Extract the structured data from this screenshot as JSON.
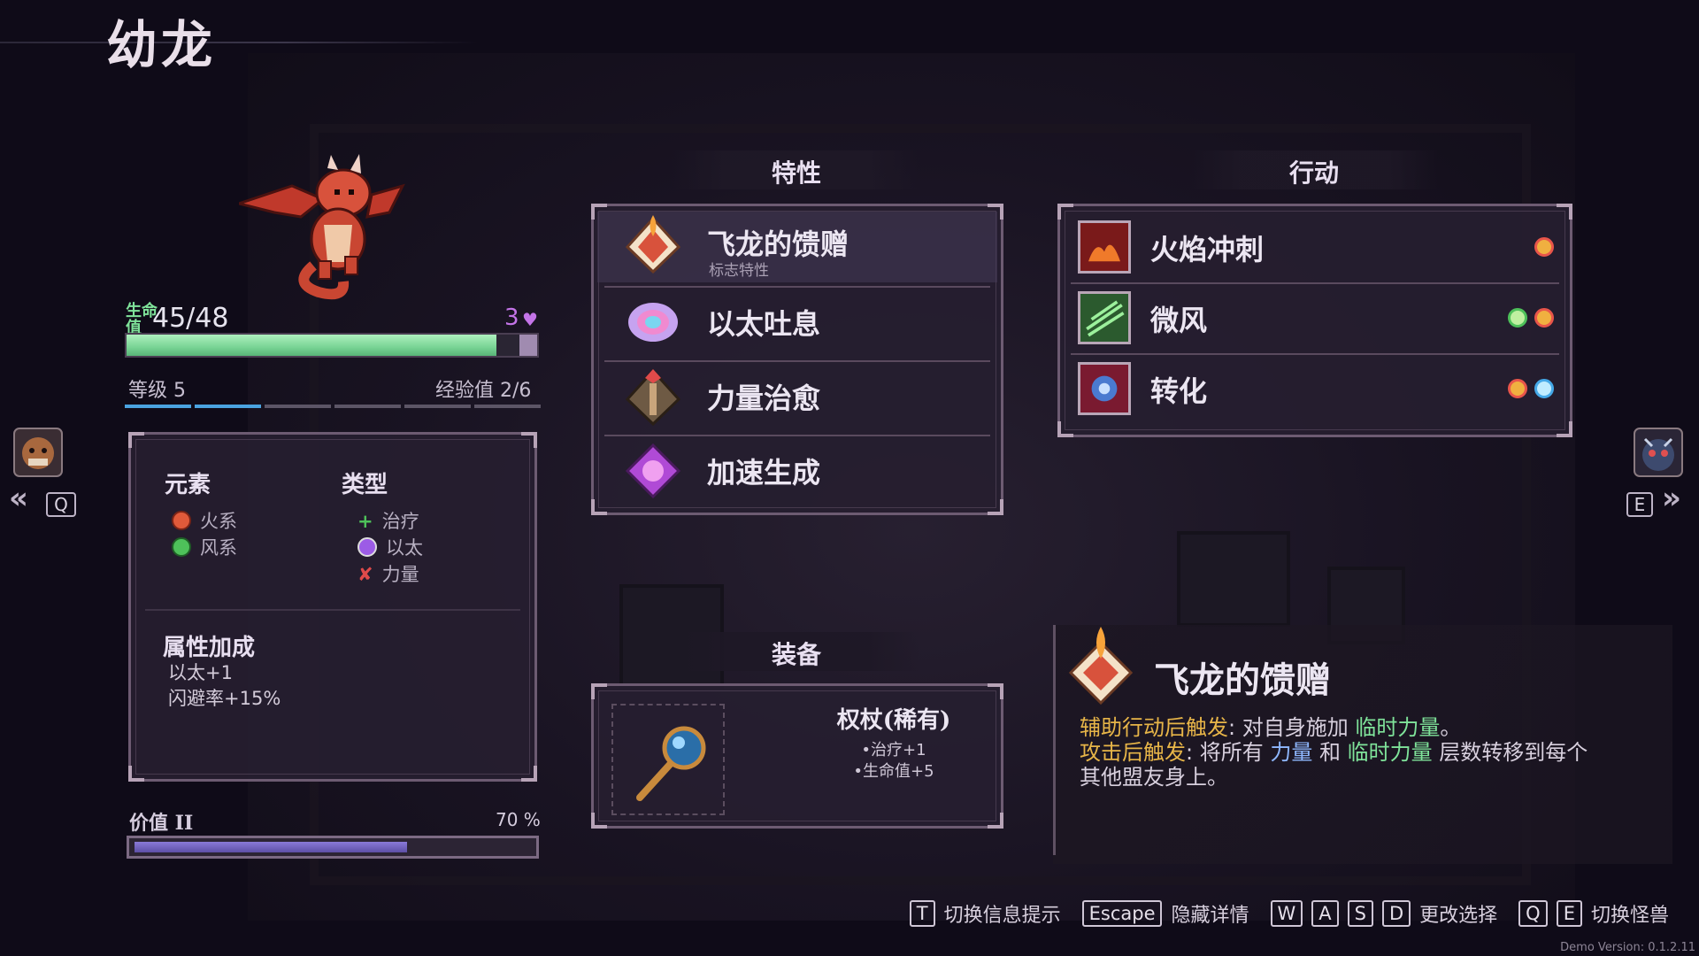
{
  "title": "幼龙",
  "hp": {
    "label": "生命值",
    "value": "45/48",
    "current": 45,
    "max": 48,
    "shield": "3"
  },
  "level": {
    "label": "等级 5",
    "xp": "经验值 2/6",
    "xp_current": 2,
    "xp_max": 6
  },
  "nav": {
    "prev_key": "Q",
    "next_key": "E"
  },
  "stats": {
    "element_header": "元素",
    "type_header": "类型",
    "elements": [
      {
        "label": "火系",
        "color": "#e05a3a"
      },
      {
        "label": "风系",
        "color": "#4ec15a"
      }
    ],
    "types": [
      {
        "label": "治疗",
        "icon": "plus-icon",
        "color": "#4ec15a"
      },
      {
        "label": "以太",
        "icon": "aether-icon",
        "color": "#9c5ce6"
      },
      {
        "label": "力量",
        "icon": "strength-icon",
        "color": "#e04a4a"
      }
    ],
    "bonus_header": "属性加成",
    "bonuses": [
      "以太+1",
      "闪避率+15%"
    ]
  },
  "worth": {
    "label": "价值 II",
    "percent": "70 %",
    "fraction": 0.7
  },
  "traits": {
    "header": "特性",
    "items": [
      {
        "name": "飞龙的馈赠",
        "sub": "标志特性",
        "icon": "dragon-gift-icon"
      },
      {
        "name": "以太吐息",
        "sub": "",
        "icon": "aether-breath-icon"
      },
      {
        "name": "力量治愈",
        "sub": "",
        "icon": "strength-heal-icon"
      },
      {
        "name": "加速生成",
        "sub": "",
        "icon": "accelerate-icon"
      }
    ]
  },
  "actions": {
    "header": "行动",
    "items": [
      {
        "name": "火焰冲刺",
        "icon": "fire-dash-icon",
        "orbs": [
          "#e8554a"
        ]
      },
      {
        "name": "微风",
        "icon": "breeze-icon",
        "orbs": [
          "#4ec15a",
          "#e8554a"
        ]
      },
      {
        "name": "转化",
        "icon": "transform-icon",
        "orbs": [
          "#e8554a",
          "#45a9e8"
        ]
      }
    ]
  },
  "equipment": {
    "header": "装备",
    "name": "权杖(稀有)",
    "stats": [
      "•治疗+1",
      "•生命值+5"
    ]
  },
  "detail": {
    "title": "飞龙的馈赠",
    "line1_trigger": "辅助行动后触发",
    "line1_sep": ":",
    "line1_pre": "对自身施加",
    "line1_kw": "临时力量",
    "line1_end": "。",
    "line2_trigger": "攻击后触发",
    "line2_sep": ":",
    "line2_pre": "将所有",
    "line2_kw1": "力量",
    "line2_mid": "和",
    "line2_kw2": "临时力量",
    "line2_end": "层数转移到每个",
    "line3": "其他盟友身上。"
  },
  "footer": {
    "t_key": "T",
    "t_label": "切换信息提示",
    "esc_key": "Escape",
    "esc_label": "隐藏详情",
    "w_key": "W",
    "a_key": "A",
    "s_key": "S",
    "d_key": "D",
    "move_label": "更改选择",
    "q_key": "Q",
    "e_key": "E",
    "swap_label": "切换怪兽",
    "version": "Demo Version: 0.1.2.11"
  }
}
